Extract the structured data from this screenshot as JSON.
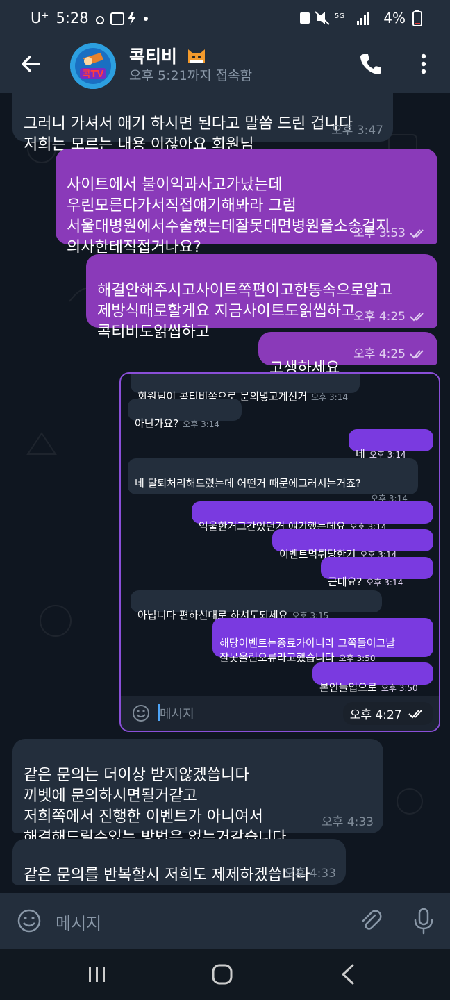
{
  "statusbar": {
    "carrier": "U⁺",
    "time": "5:28",
    "battery": "4%",
    "network": "5G"
  },
  "header": {
    "title": "콕티비",
    "status": "오후 5:21까지 접속함",
    "avatar_text": "콕TV"
  },
  "messages": [
    {
      "dir": "in",
      "text": "그러니 가셔서 애기 하시면 된다고 말씀 드린 겁니다\n저희는 모르는 내용 이잖아요 회원님",
      "time": "오후 3:47"
    },
    {
      "dir": "out",
      "text": "사이트에서 불이익과사고가났는데\n우린모른다가서직접얘기해봐라 그럼\n서울대병원에서수술했는데잘못대면병원을소송걸지\n의사한테직접거나요?",
      "time": "오후 3:53"
    },
    {
      "dir": "out",
      "text": "해결안해주시고사이트쪽편이고한통속으로알고\n제방식때로할게요 지금사이트도읽씹하고\n콕티비도읽씹하고",
      "time": "오후 4:25"
    },
    {
      "dir": "out",
      "text": "고생하세요",
      "time": "오후 4:25"
    },
    {
      "dir": "in",
      "text": "같은 문의는 더이상 받지않겠씁니다\n끼벳에 문의하시면될거같고\n저희쪽에서 진행한 이벤트가 아니여서\n해결해드릴수있는 방법은 없는거같습니다",
      "time": "오후 4:33"
    },
    {
      "dir": "in",
      "text": "같은 문의를 반복할시 저희도 제제하겠씁니다",
      "time": "오후 4:33"
    }
  ],
  "screenshot": {
    "time": "오후 4:27",
    "input_placeholder": "메시지",
    "messages": [
      {
        "dir": "in",
        "text": "회원님이 콕티비쪽으로 문의넣고계신거",
        "time": "오후 3:14"
      },
      {
        "dir": "in",
        "text": "아닌가요?",
        "time": "오후 3:14"
      },
      {
        "dir": "out",
        "text": "네",
        "time": "오후 3:14"
      },
      {
        "dir": "in",
        "text": "네 탈퇴처리해드렸는데 어떤거 때문에그러시는거죠?",
        "time": "오후 3:14"
      },
      {
        "dir": "out",
        "text": "억울한거그간있던거 얘기했는데요",
        "time": "오후 3:14"
      },
      {
        "dir": "out",
        "text": "이벤트먹튀당한거",
        "time": "오후 3:14"
      },
      {
        "dir": "out",
        "text": "근데요?",
        "time": "오후 3:14"
      },
      {
        "dir": "in",
        "text": "아닙니다 편하신대로 하셔도되세요",
        "time": "오후 3:15"
      },
      {
        "dir": "out",
        "text": "해당이벤트는종료가아니라 그쪽들이그날\n잘못올린오류라고했습니다",
        "time": "오후 3:50"
      },
      {
        "dir": "out",
        "text": "본인들입으로",
        "time": "오후 3:50"
      }
    ]
  },
  "input": {
    "placeholder": "메시지"
  },
  "colors": {
    "accent": "#8a3ab9",
    "header_bg": "#232e3c",
    "chat_bg": "#0f1620"
  }
}
